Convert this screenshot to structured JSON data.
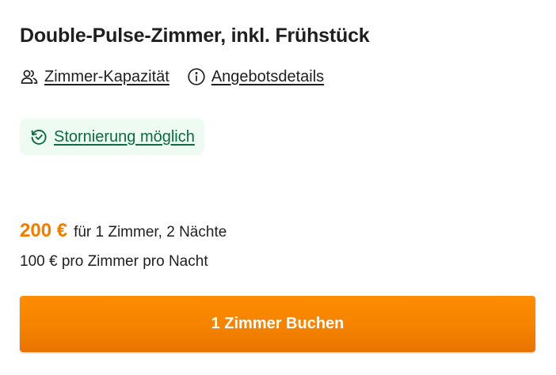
{
  "room": {
    "title": "Double-Pulse-Zimmer, inkl. Frühstück"
  },
  "links": {
    "capacity_label": "Zimmer-Kapazität",
    "capacity_icon": "users-icon",
    "details_label": "Angebotsdetails",
    "details_icon": "info-icon"
  },
  "cancellation": {
    "label": "Stornierung möglich",
    "icon": "refresh-check-icon"
  },
  "price": {
    "total": "200 €",
    "total_description": "für 1 Zimmer, 2 Nächte",
    "per_night": "100 € pro Zimmer pro Nacht"
  },
  "book_button": {
    "label": "1 Zimmer Buchen"
  },
  "colors": {
    "accent": "#f58300",
    "cancel_text": "#0d6b3f",
    "cancel_bg": "#edfbf3",
    "text": "#1f1f1f"
  }
}
